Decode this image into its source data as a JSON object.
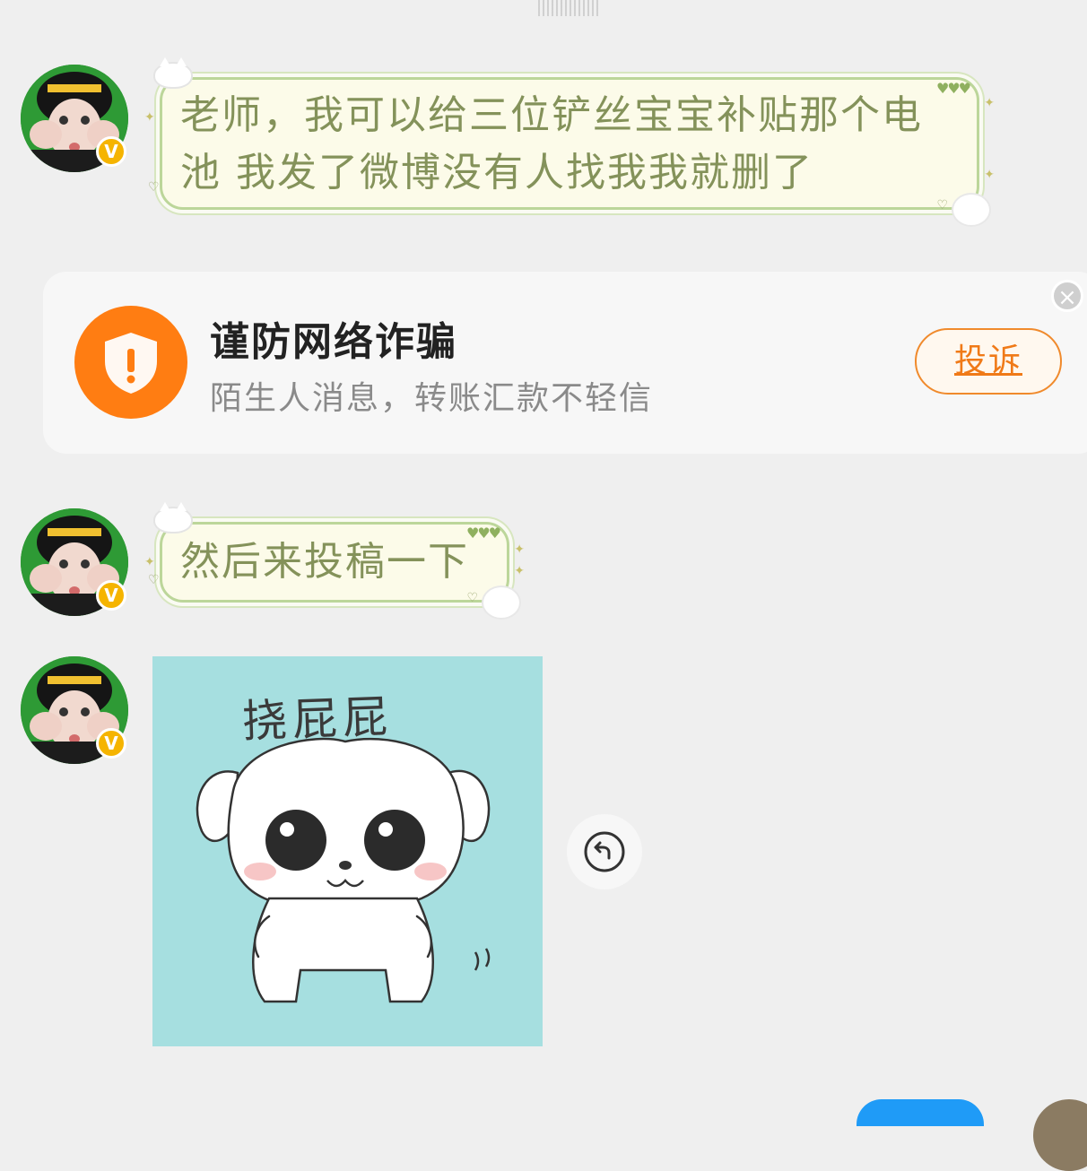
{
  "messages": [
    {
      "text_line1": "老师，我可以给三位铲丝宝宝补贴那个电",
      "text_line2": "池 我发了微博没有人找我我就删了"
    },
    {
      "text": "然后来投稿一下"
    }
  ],
  "fraud_notice": {
    "title": "谨防网络诈骗",
    "subtitle": "陌生人消息，转账汇款不轻信",
    "report_label": "投诉",
    "close_icon": "close-icon"
  },
  "sticker": {
    "caption": "挠屁屁",
    "background_color": "#a6dfe0"
  },
  "avatar": {
    "badge_label": "V",
    "badge_color": "#f5b400"
  },
  "colors": {
    "bubble_text": "#84925a",
    "bubble_border": "#bcd69a",
    "accent_orange": "#ff7d12"
  }
}
